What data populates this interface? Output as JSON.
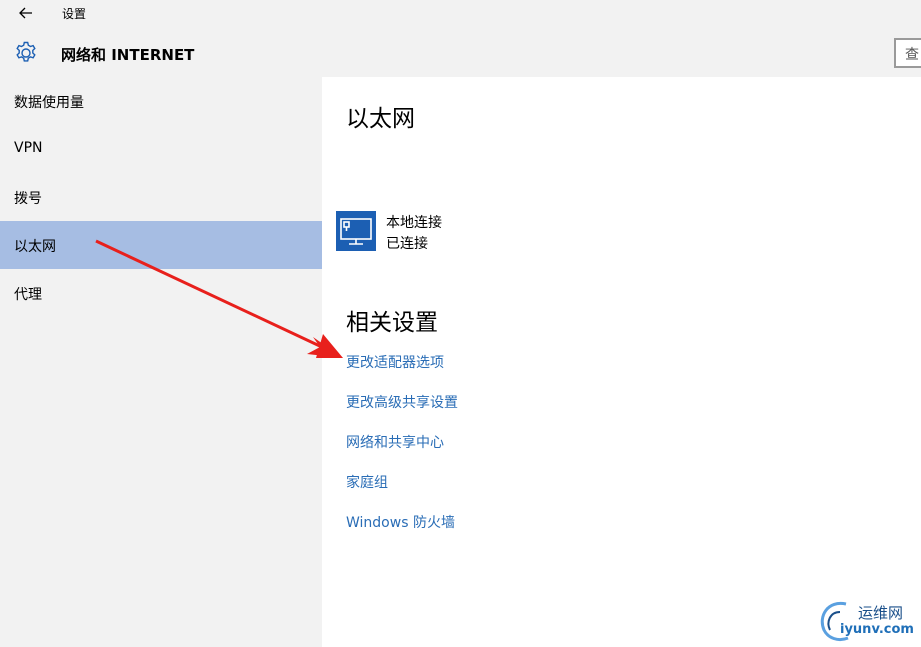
{
  "window": {
    "title": "设置"
  },
  "header": {
    "title": "网络和 INTERNET",
    "search_placeholder": "查"
  },
  "sidebar": {
    "items": [
      {
        "label": "数据使用量",
        "selected": false
      },
      {
        "label": "VPN",
        "selected": false
      },
      {
        "label": "拨号",
        "selected": false
      },
      {
        "label": "以太网",
        "selected": true
      },
      {
        "label": "代理",
        "selected": false
      }
    ]
  },
  "main": {
    "heading": "以太网",
    "connection": {
      "name": "本地连接",
      "status": "已连接",
      "icon": "ethernet-monitor-icon"
    },
    "related_heading": "相关设置",
    "links": [
      "更改适配器选项",
      "更改高级共享设置",
      "网络和共享中心",
      "家庭组",
      "Windows 防火墙"
    ]
  },
  "watermark": {
    "text_cn": "运维网",
    "text_en": "iyunv.com"
  },
  "colors": {
    "chrome_bg": "#f2f2f2",
    "selected_bg": "#a6bde3",
    "link": "#2a6db6",
    "tile": "#1c5fb3",
    "annotation_arrow": "#e8201c"
  }
}
